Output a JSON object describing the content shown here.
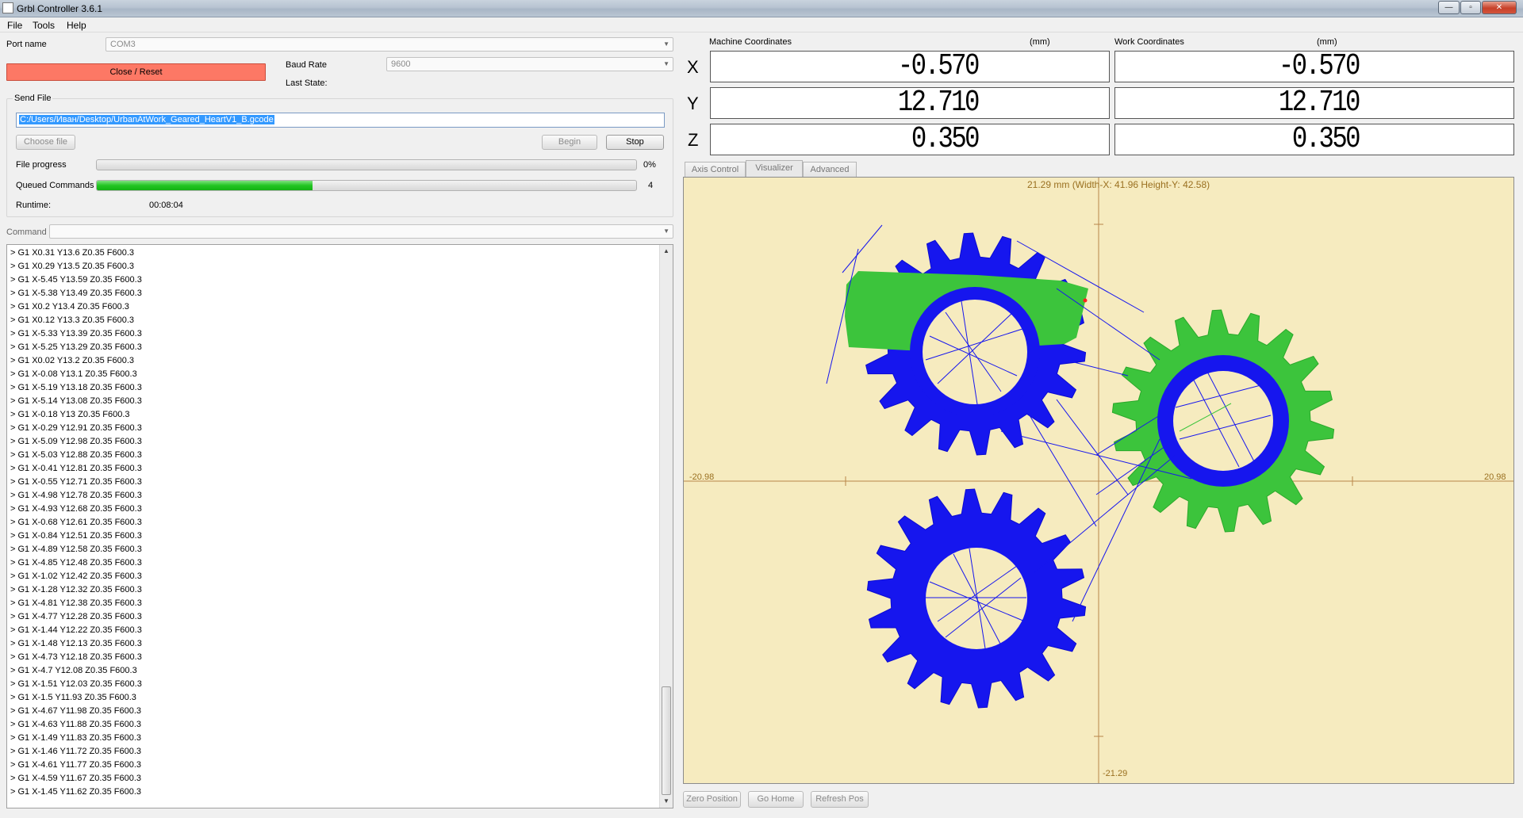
{
  "window": {
    "title": "Grbl Controller 3.6.1",
    "min": "—",
    "max": "▫",
    "close": "✕"
  },
  "menu": {
    "file": "File",
    "tools": "Tools",
    "help": "Help"
  },
  "connection": {
    "port_label": "Port name",
    "port_value": "COM3",
    "close_reset": "Close / Reset",
    "baud_label": "Baud Rate",
    "baud_value": "9600",
    "last_state_label": "Last State:",
    "last_state_value": ""
  },
  "send_file": {
    "group_label": "Send File",
    "path": "C:/Users/Иван/Desktop/UrbanAtWork_Geared_HeartV1_B.gcode",
    "choose_label": "Choose file",
    "begin_label": "Begin",
    "stop_label": "Stop",
    "progress_label": "File progress",
    "progress_text": "0%",
    "progress_value": 0,
    "queued_label": "Queued Commands",
    "queued_text": "4",
    "queued_fraction": 0.4,
    "runtime_label": "Runtime:",
    "runtime_value": "00:08:04"
  },
  "command": {
    "label": "Command",
    "value": ""
  },
  "console_lines": [
    "> G1 X0.31 Y13.6 Z0.35 F600.3",
    "> G1 X0.29 Y13.5 Z0.35 F600.3",
    "> G1 X-5.45 Y13.59 Z0.35 F600.3",
    "> G1 X-5.38 Y13.49 Z0.35 F600.3",
    "> G1 X0.2 Y13.4 Z0.35 F600.3",
    "> G1 X0.12 Y13.3 Z0.35 F600.3",
    "> G1 X-5.33 Y13.39 Z0.35 F600.3",
    "> G1 X-5.25 Y13.29 Z0.35 F600.3",
    "> G1 X0.02 Y13.2 Z0.35 F600.3",
    "> G1 X-0.08 Y13.1 Z0.35 F600.3",
    "> G1 X-5.19 Y13.18 Z0.35 F600.3",
    "> G1 X-5.14 Y13.08 Z0.35 F600.3",
    "> G1 X-0.18 Y13 Z0.35 F600.3",
    "> G1 X-0.29 Y12.91 Z0.35 F600.3",
    "> G1 X-5.09 Y12.98 Z0.35 F600.3",
    "> G1 X-5.03 Y12.88 Z0.35 F600.3",
    "> G1 X-0.41 Y12.81 Z0.35 F600.3",
    "> G1 X-0.55 Y12.71 Z0.35 F600.3",
    "> G1 X-4.98 Y12.78 Z0.35 F600.3",
    "> G1 X-4.93 Y12.68 Z0.35 F600.3",
    "> G1 X-0.68 Y12.61 Z0.35 F600.3",
    "> G1 X-0.84 Y12.51 Z0.35 F600.3",
    "> G1 X-4.89 Y12.58 Z0.35 F600.3",
    "> G1 X-4.85 Y12.48 Z0.35 F600.3",
    "> G1 X-1.02 Y12.42 Z0.35 F600.3",
    "> G1 X-1.28 Y12.32 Z0.35 F600.3",
    "> G1 X-4.81 Y12.38 Z0.35 F600.3",
    "> G1 X-4.77 Y12.28 Z0.35 F600.3",
    "> G1 X-1.44 Y12.22 Z0.35 F600.3",
    "> G1 X-1.48 Y12.13 Z0.35 F600.3",
    "> G1 X-4.73 Y12.18 Z0.35 F600.3",
    "> G1 X-4.7 Y12.08 Z0.35 F600.3",
    "> G1 X-1.51 Y12.03 Z0.35 F600.3",
    "> G1 X-1.5 Y11.93 Z0.35 F600.3",
    "> G1 X-4.67 Y11.98 Z0.35 F600.3",
    "> G1 X-4.63 Y11.88 Z0.35 F600.3",
    "> G1 X-1.49 Y11.83 Z0.35 F600.3",
    "> G1 X-1.46 Y11.72 Z0.35 F600.3",
    "> G1 X-4.61 Y11.77 Z0.35 F600.3",
    "> G1 X-4.59 Y11.67 Z0.35 F600.3",
    "> G1 X-1.45 Y11.62 Z0.35 F600.3"
  ],
  "coordinates": {
    "machine_label": "Machine Coordinates",
    "work_label": "Work Coordinates",
    "unit": "(mm)",
    "axes": [
      {
        "axis": "X",
        "machine": "-0.570",
        "work": "-0.570"
      },
      {
        "axis": "Y",
        "machine": "12.710",
        "work": "12.710"
      },
      {
        "axis": "Z",
        "machine": "0.350",
        "work": "0.350"
      }
    ]
  },
  "tabs": [
    "Axis Control",
    "Visualizer",
    "Advanced"
  ],
  "active_tab": "Visualizer",
  "visualizer": {
    "info": "21.29 mm  (Width-X: 41.96  Height-Y: 42.58)",
    "x_min_label": "-20.98",
    "x_max_label": "20.98",
    "y_min_label": "-21.29",
    "colors": {
      "background": "#f6ebbf",
      "path": "#1010ee",
      "done": "#3cc43c",
      "axis": "#b8864a",
      "label": "#9a7020"
    }
  },
  "bottom_buttons": {
    "zero": "Zero Position",
    "home": "Go Home",
    "refresh": "Refresh Pos"
  }
}
